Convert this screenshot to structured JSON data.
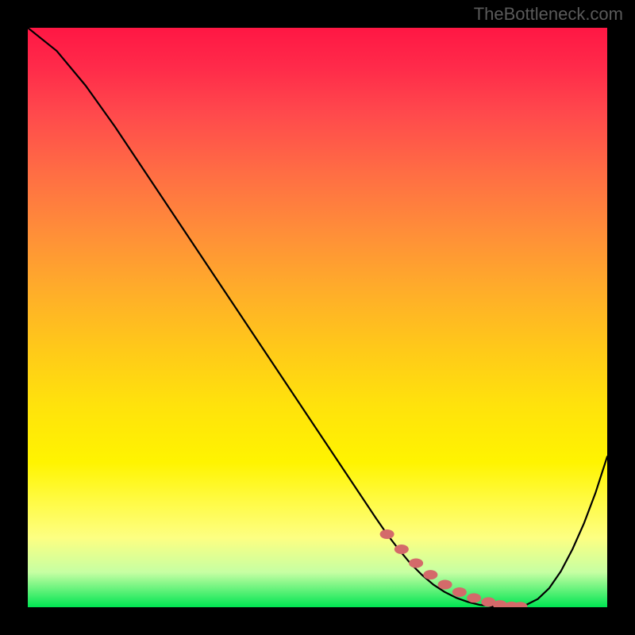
{
  "watermark": "TheBottleneck.com",
  "chart_data": {
    "type": "line",
    "title": "",
    "xlabel": "",
    "ylabel": "",
    "xlim": [
      0,
      100
    ],
    "ylim": [
      0,
      100
    ],
    "grid": false,
    "curve": {
      "x": [
        0,
        5,
        10,
        15,
        20,
        25,
        30,
        35,
        40,
        45,
        50,
        55,
        60,
        62,
        64,
        66,
        68,
        70,
        72,
        74,
        76,
        78,
        80,
        82,
        84,
        86,
        88,
        90,
        92,
        94,
        96,
        98,
        100
      ],
      "y": [
        100,
        96,
        90,
        83,
        75.5,
        68,
        60.5,
        53,
        45.5,
        38,
        30.5,
        23,
        15.5,
        12.6,
        10,
        7.6,
        5.6,
        3.9,
        2.6,
        1.6,
        0.9,
        0.4,
        0.15,
        0.05,
        0.1,
        0.4,
        1.4,
        3.3,
        6.2,
        10,
        14.5,
        19.8,
        26
      ]
    },
    "marker_points": {
      "x": [
        62,
        64.5,
        67,
        69.5,
        72,
        74.5,
        77,
        79.5,
        81.5,
        83.5,
        85
      ],
      "y": [
        12.6,
        10,
        7.6,
        5.6,
        3.9,
        2.6,
        1.6,
        0.9,
        0.4,
        0.15,
        0.1
      ]
    }
  }
}
